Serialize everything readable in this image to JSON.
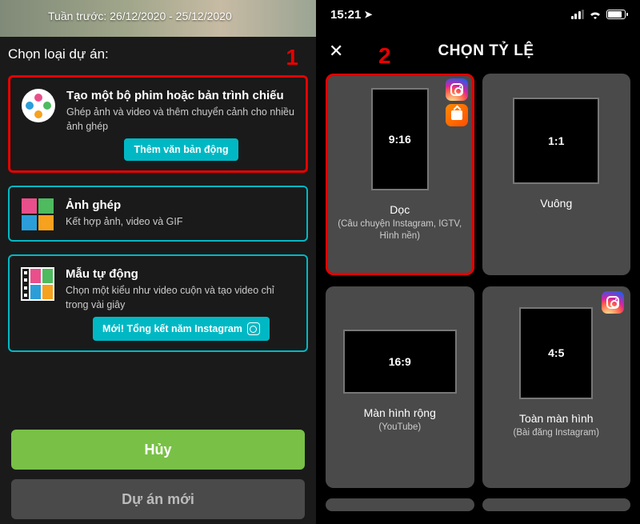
{
  "left": {
    "top_text": "Tuần trước: 26/12/2020 - 25/12/2020",
    "section_title": "Chọn loại dự án:",
    "annotation_1": "1",
    "options": [
      {
        "title": "Tạo một bộ phim hoặc bản trình chiếu",
        "desc": "Ghép ảnh và video và thêm chuyển cảnh cho nhiều ảnh ghép",
        "badge": "Thêm văn bản động"
      },
      {
        "title": "Ảnh ghép",
        "desc": "Kết hợp ảnh, video và GIF"
      },
      {
        "title": "Mẫu tự động",
        "desc": "Chọn một kiểu như video cuộn và tạo video chỉ trong vài giây",
        "badge": "Mới! Tổng kết năm Instagram"
      }
    ],
    "cancel_label": "Hủy",
    "new_project_label": "Dự án mới"
  },
  "right": {
    "status_time": "15:21",
    "annotation_2": "2",
    "title": "CHỌN TỶ LỆ",
    "ratios": [
      {
        "label": "9:16",
        "name": "Dọc",
        "sub": "(Câu chuyện Instagram, IGTV, Hình nền)"
      },
      {
        "label": "1:1",
        "name": "Vuông",
        "sub": ""
      },
      {
        "label": "16:9",
        "name": "Màn hình rộng",
        "sub": "(YouTube)"
      },
      {
        "label": "4:5",
        "name": "Toàn màn hình",
        "sub": "(Bài đăng Instagram)"
      }
    ]
  }
}
